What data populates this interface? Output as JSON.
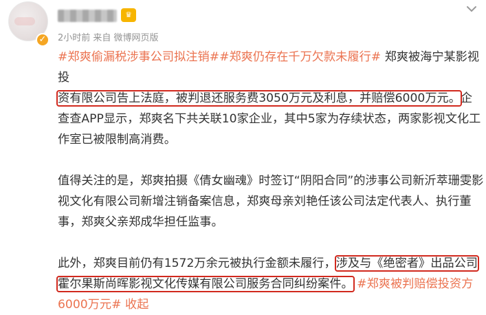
{
  "post": {
    "meta": "2小时前 来自 微博网页版",
    "badge_icon": "fan-badge-icon",
    "verified_icon": "verified-icon",
    "menu_icon": "chevron-down-icon",
    "accent_color": "#eb7350",
    "highlight_color": "#d1281d",
    "p1": {
      "tag1": "#郑爽偷漏税涉事公司拟注销#",
      "tag2": "#郑爽仍存在千万欠款未履行#",
      "t1": " 郑爽被海宁某影视投",
      "boxed": "资有限公司告上法庭，被判退还服务费3050万元及利息，并赔偿6000万元。",
      "t2": "企查查APP显示，郑爽名下共关联10家企业，其中5家为存续状态，两家影视文化工作室已被限制高消费。"
    },
    "p2": "值得关注的是，郑爽拍摄《倩女幽魂》时签订“阴阳合同”的涉事公司新沂萃珊雯影视文化有限公司新增注销备案信息，郑爽母亲刘艳任该公司法定代表人、执行董事，郑爽父亲郑成华担任监事。",
    "p3": {
      "t1": "此外，郑爽目前仍有1572万余元被执行金额未履行，",
      "boxed1": "涉及与《绝密者》出品公司",
      "boxed2": "霍尔果斯尚晖影视文化传媒有限公司服务合同纠纷案件。",
      "tag": "#郑爽被判赔偿投资方6000万元#",
      "fold": "收起"
    }
  }
}
